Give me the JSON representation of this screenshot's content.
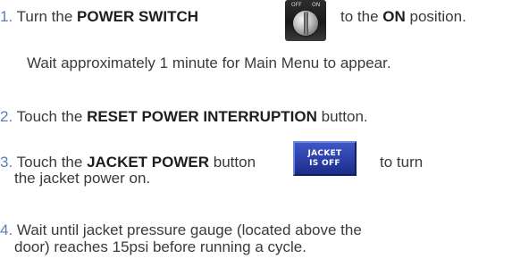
{
  "steps": [
    {
      "number": "1.",
      "pre": "Turn the ",
      "bold1": "POWER SWITCH",
      "mid": "to the ",
      "bold2": "ON",
      "post": " position.",
      "note": "Wait approximately 1 minute for Main Menu to appear."
    },
    {
      "number": "2.",
      "pre": "Touch the ",
      "bold1": "RESET POWER INTERRUPTION",
      "post": " button."
    },
    {
      "number": "3.",
      "pre": "Touch the ",
      "bold1": "JACKET POWER",
      "mid": " button",
      "post": "to turn",
      "line2": "the jacket power on."
    },
    {
      "number": "4.",
      "line1": "Wait until jacket pressure gauge (located above the",
      "line2": "door) reaches 15psi before running a cycle."
    }
  ],
  "icons": {
    "power_switch": {
      "name": "power-switch-icon",
      "label_off": "OFF",
      "label_on": "ON"
    },
    "jacket_button": {
      "name": "jacket-power-button-icon",
      "line1": "JACKET",
      "line2": "IS OFF",
      "color": "#2a3fa8"
    }
  },
  "colors": {
    "number": "#5d7fb2",
    "text": "#3a3a3a",
    "bold": "#1e1e1e"
  }
}
